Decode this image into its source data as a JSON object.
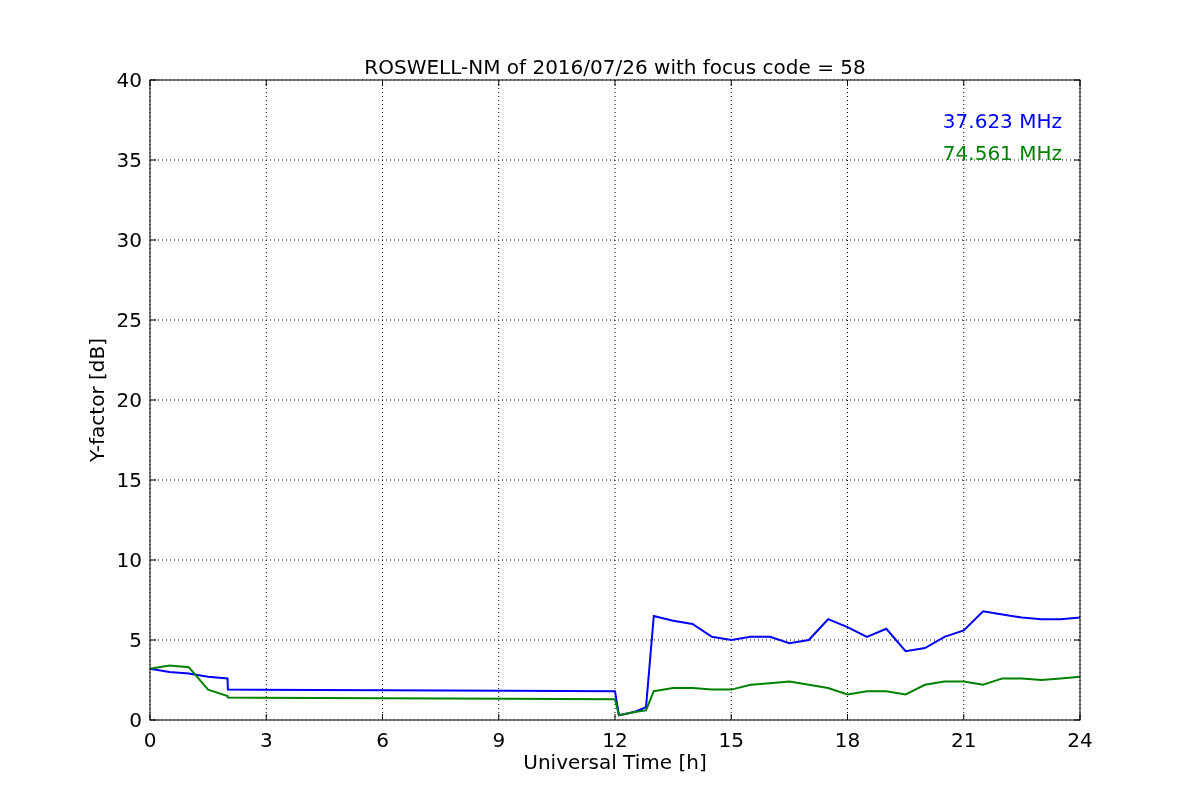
{
  "figure": {
    "chart_data": {
      "type": "line",
      "title": "ROSWELL-NM of 2016/07/26 with focus code = 58",
      "xlabel": "Universal Time [h]",
      "ylabel": "Y-factor [dB]",
      "x": [
        0,
        0.5,
        1,
        1.5,
        2,
        2.01,
        12,
        12.1,
        12.5,
        12.8,
        13,
        13.5,
        14,
        14.5,
        15,
        15.5,
        16,
        16.5,
        17,
        17.5,
        18,
        18.5,
        19,
        19.5,
        20,
        20.5,
        21,
        21.5,
        22,
        22.5,
        23,
        23.5,
        24
      ],
      "series": [
        {
          "name": "37.623 MHz",
          "color": "#0000ff",
          "values": [
            3.2,
            3.0,
            2.9,
            2.7,
            2.6,
            1.9,
            1.8,
            0.3,
            0.5,
            0.8,
            6.5,
            6.2,
            6.0,
            5.2,
            5.0,
            5.2,
            5.2,
            4.8,
            5.0,
            6.3,
            5.8,
            5.2,
            5.7,
            4.3,
            4.5,
            5.2,
            5.6,
            6.8,
            6.6,
            6.4,
            6.3,
            6.3,
            6.4
          ]
        },
        {
          "name": "74.561 MHz",
          "color": "#008000",
          "values": [
            3.2,
            3.4,
            3.3,
            1.9,
            1.5,
            1.4,
            1.3,
            0.3,
            0.5,
            0.6,
            1.8,
            2.0,
            2.0,
            1.9,
            1.9,
            2.2,
            2.3,
            2.4,
            2.2,
            2.0,
            1.6,
            1.8,
            1.8,
            1.6,
            2.2,
            2.4,
            2.4,
            2.2,
            2.6,
            2.6,
            2.5,
            2.6,
            2.7
          ]
        }
      ],
      "xlim": [
        0,
        24
      ],
      "ylim": [
        0,
        40
      ],
      "xticks": [
        0,
        3,
        6,
        9,
        12,
        15,
        18,
        21,
        24
      ],
      "yticks": [
        0,
        5,
        10,
        15,
        20,
        25,
        30,
        35,
        40
      ],
      "grid": true
    }
  }
}
